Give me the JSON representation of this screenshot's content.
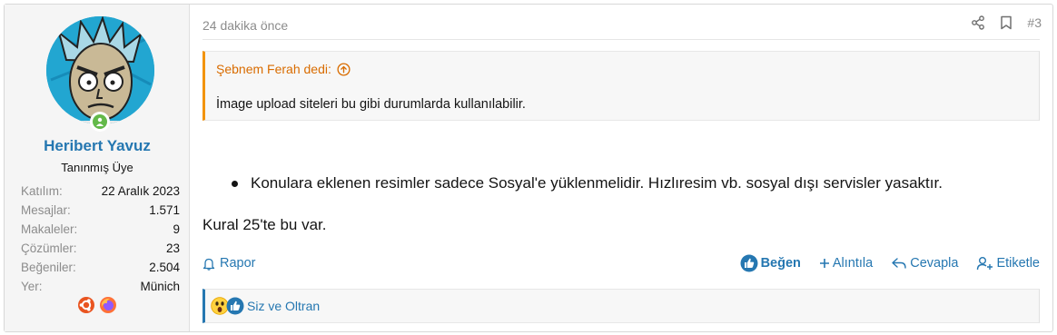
{
  "user": {
    "name": "Heribert Yavuz",
    "title": "Tanınmış Üye",
    "stats": [
      {
        "label": "Katılım:",
        "value": "22 Aralık 2023"
      },
      {
        "label": "Mesajlar:",
        "value": "1.571"
      },
      {
        "label": "Makaleler:",
        "value": "9"
      },
      {
        "label": "Çözümler:",
        "value": "23"
      },
      {
        "label": "Beğeniler:",
        "value": "2.504"
      },
      {
        "label": "Yer:",
        "value": "Münich"
      }
    ],
    "badges": [
      "ubuntu-icon",
      "firefox-icon"
    ]
  },
  "post": {
    "date": "24 dakika önce",
    "number": "#3",
    "quote": {
      "author_line": "Şebnem Ferah dedi:",
      "text": "İmage upload siteleri bu gibi durumlarda kullanılabilir."
    },
    "bullet": "Konulara eklenen resimler sadece Sosyal'e yüklenmelidir. Hızlıresim vb. sosyal dışı servisler yasaktır.",
    "paragraph": "Kural 25'te bu var."
  },
  "footer": {
    "report": "Rapor",
    "like": "Beğen",
    "quote": "Alıntıla",
    "reply": "Cevapla",
    "tag": "Etiketle"
  },
  "reactions": {
    "text": "Siz ve Oltran",
    "icons": [
      "wow-reaction-icon",
      "like-reaction-icon"
    ]
  },
  "colors": {
    "accent": "#2577b1",
    "quote_accent": "#f2930d",
    "online": "#63b949"
  }
}
